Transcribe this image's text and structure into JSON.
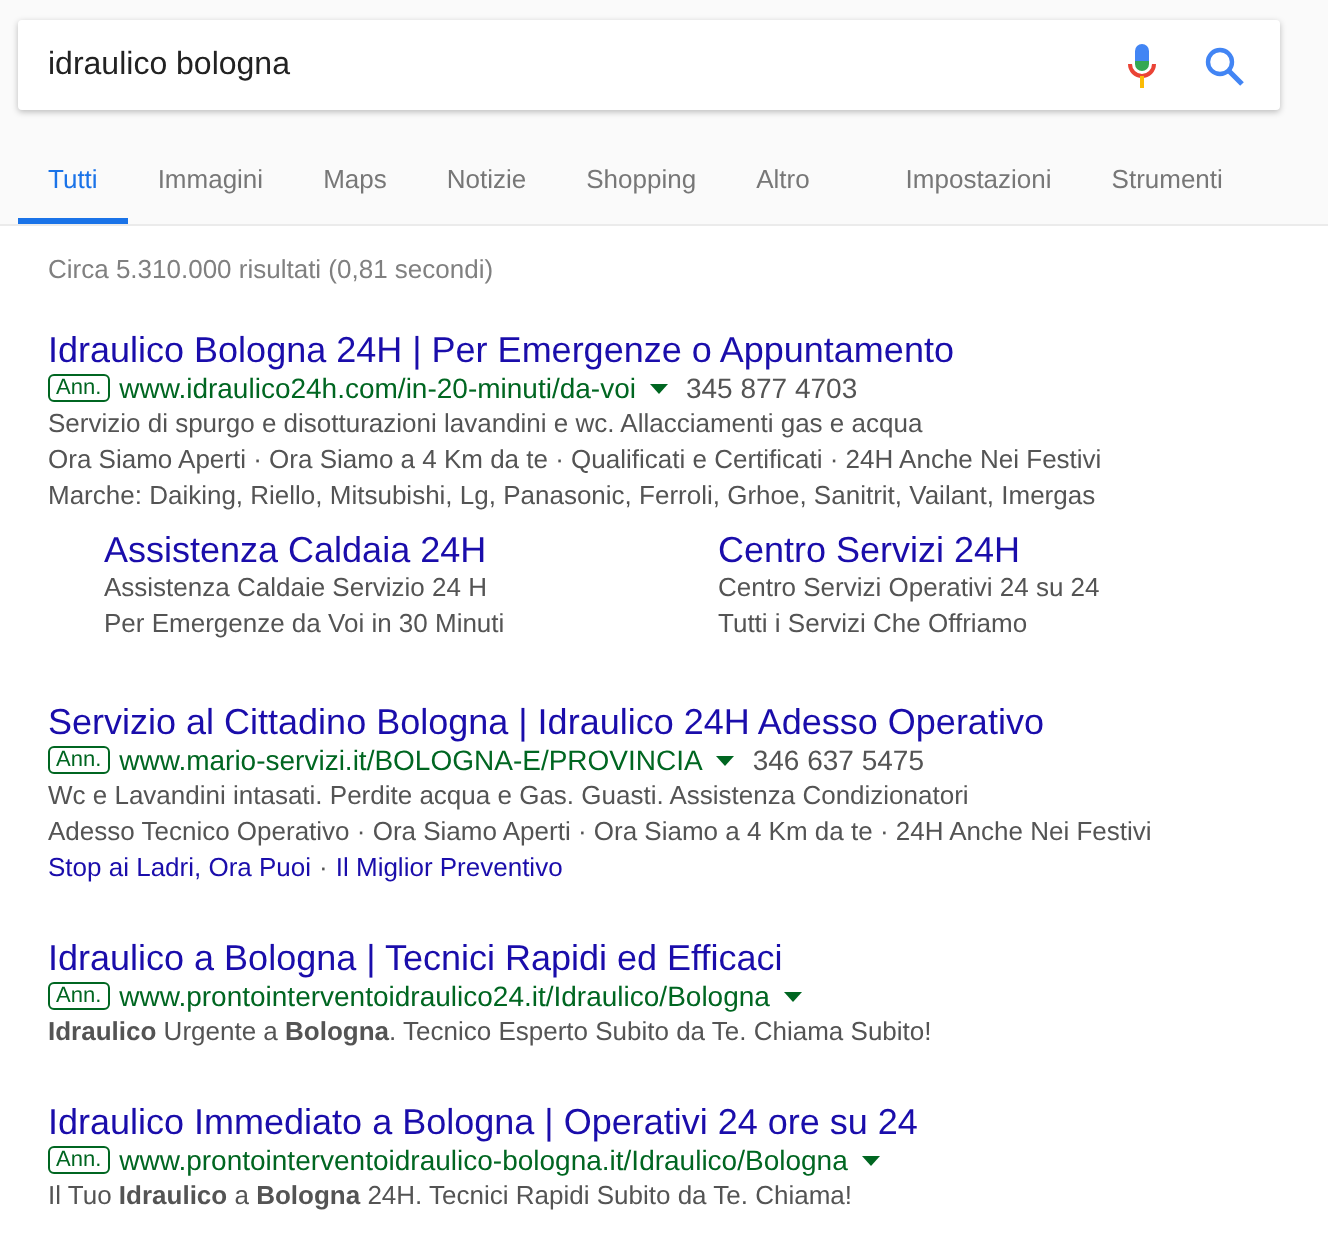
{
  "search": {
    "value": "idraulico bologna"
  },
  "tabs": [
    {
      "label": "Tutti",
      "selected": true
    },
    {
      "label": "Immagini",
      "selected": false
    },
    {
      "label": "Maps",
      "selected": false
    },
    {
      "label": "Notizie",
      "selected": false
    },
    {
      "label": "Shopping",
      "selected": false
    },
    {
      "label": "Altro",
      "selected": false
    }
  ],
  "tools": [
    "Impostazioni",
    "Strumenti"
  ],
  "result_stats": "Circa 5.310.000 risultati (0,81 secondi)",
  "ads": [
    {
      "title": "Idraulico Bologna 24H | Per Emergenze o Appuntamento",
      "badge": "Ann.",
      "url": "www.idraulico24h.com/in-20-minuti/da-voi",
      "phone": "345 877 4703",
      "lines": [
        "Servizio di spurgo e disotturazioni lavandini e wc. Allacciamenti gas e acqua",
        "Ora Siamo Aperti · Ora Siamo a 4 Km da te · Qualificati e Certificati · 24H Anche Nei Festivi",
        "Marche: Daiking, Riello, Mitsubishi, Lg, Panasonic, Ferroli, Grhoe, Sanitrit, Vailant, Imergas"
      ],
      "sitelinks": [
        {
          "title": "Assistenza Caldaia 24H",
          "lines": [
            "Assistenza Caldaie Servizio 24 H",
            "Per Emergenze da Voi in 30 Minuti"
          ]
        },
        {
          "title": "Centro Servizi 24H",
          "lines": [
            "Centro Servizi Operativi 24 su 24",
            "Tutti i Servizi Che Offriamo"
          ]
        }
      ]
    },
    {
      "title": "Servizio al Cittadino Bologna | Idraulico 24H Adesso Operativo",
      "badge": "Ann.",
      "url": "www.mario-servizi.it/BOLOGNA-E/PROVINCIA",
      "phone": "346 637 5475",
      "lines": [
        "Wc e Lavandini intasati. Perdite acqua e Gas. Guasti. Assistenza Condizionatori",
        "Adesso Tecnico Operativo · Ora Siamo Aperti · Ora Siamo a 4 Km da te · 24H Anche Nei Festivi"
      ],
      "inline_links": [
        "Stop ai Ladri, Ora Puoi",
        "Il Miglior Preventivo"
      ],
      "link_separator": "·"
    },
    {
      "title": "Idraulico a Bologna | Tecnici Rapidi ed Efficaci",
      "badge": "Ann.",
      "url": "www.prontointerventoidraulico24.it/Idraulico/Bologna",
      "lines": [
        "**Idraulico** Urgente a **Bologna**. Tecnico Esperto Subito da Te. Chiama Subito!"
      ]
    },
    {
      "title": "Idraulico Immediato a Bologna | Operativi 24 ore su 24",
      "badge": "Ann.",
      "url": "www.prontointerventoidraulico-bologna.it/Idraulico/Bologna",
      "lines": [
        "Il Tuo **Idraulico** a **Bologna** 24H. Tecnici Rapidi Subito da Te. Chiama!"
      ]
    }
  ]
}
